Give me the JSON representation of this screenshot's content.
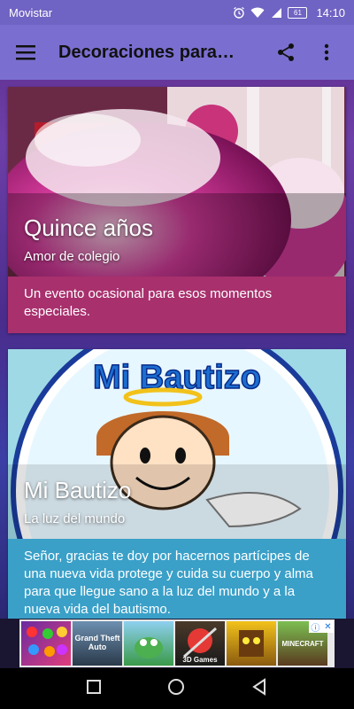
{
  "status_bar": {
    "carrier": "Movistar",
    "battery": "61",
    "time": "14:10",
    "icons": [
      "alarm-icon",
      "wifi-icon",
      "signal-icon",
      "battery-icon"
    ]
  },
  "app_bar": {
    "title": "Decoraciones para…",
    "icons": [
      "menu-icon",
      "share-icon",
      "more-vert-icon"
    ]
  },
  "cards": [
    {
      "title": "Quince años",
      "subtitle": "Amor de colegio",
      "description": "Un evento ocasional para esos momentos especiales.",
      "accent": "#a8306d"
    },
    {
      "title": "Mi Bautizo",
      "subtitle": "La luz del mundo",
      "description": "Señor, gracias te doy por hacernos partícipes de una nueva vida protege y cuida su cuerpo y alma para que llegue sano a la luz del mundo y a la nueva vida del bautismo.",
      "accent": "#3aa0c8",
      "image_text": "Mi Bautizo"
    }
  ],
  "ad": {
    "tiles": [
      "",
      "Grand Theft Auto",
      "",
      "3D Games",
      "",
      "MINECRAFT"
    ],
    "choices_icons": [
      "info-icon",
      "close-icon"
    ]
  },
  "nav_bar": {
    "icons": [
      "recents-icon",
      "home-icon",
      "back-icon"
    ]
  }
}
